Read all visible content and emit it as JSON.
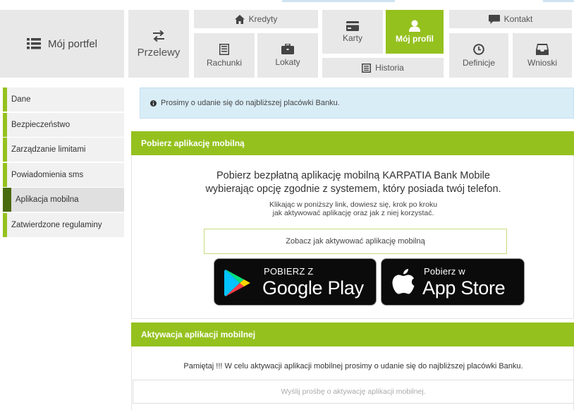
{
  "nav": {
    "portfel": "Mój portfel",
    "przelewy": "Przelewy",
    "kredyty": "Kredyty",
    "rachunki": "Rachunki",
    "lokaty": "Lokaty",
    "karty": "Karty",
    "profil": "Mój profil",
    "historia": "Historia",
    "kontakt": "Kontakt",
    "definicje": "Definicje",
    "wnioski": "Wnioski"
  },
  "sidebar": {
    "items": [
      {
        "label": "Dane"
      },
      {
        "label": "Bezpieczeństwo"
      },
      {
        "label": "Zarządzanie limitami"
      },
      {
        "label": "Powiadomienia sms"
      },
      {
        "label": "Aplikacja mobilna"
      },
      {
        "label": "Zatwierdzone regulaminy"
      }
    ]
  },
  "alert": {
    "text": "Prosimy o udanie się do najbliższej placówki Banku."
  },
  "download_panel": {
    "title": "Pobierz aplikację mobilną",
    "headline_1": "Pobierz bezpłatną aplikację mobilną KARPATIA Bank Mobile",
    "headline_2": "wybierając opcję zgodnie z systemem, który posiada twój telefon.",
    "info_1": "Klikając w poniższy link, dowiesz się, krok po kroku",
    "info_2": "jak aktywować aplikację oraz jak z niej korzystać.",
    "link_label": "Zobacz jak aktywować aplikację mobilną",
    "google_play": {
      "small": "POBIERZ Z",
      "big": "Google Play"
    },
    "app_store": {
      "small": "Pobierz w",
      "big": "App Store"
    }
  },
  "activation_panel": {
    "title": "Aktywacja aplikacji mobilnej",
    "note": "Pamiętaj !!! W celu aktywacji aplikacji mobilnej prosimy o udanie się do najbliższej placówki Banku.",
    "button_label": "Wyślij prośbę o aktywację aplikacji mobilnej."
  },
  "colors": {
    "accent": "#95c11f",
    "active_sidebar": "#4a6b0d",
    "tile": "#e8e8e8",
    "alert_bg": "#d9edf7"
  }
}
